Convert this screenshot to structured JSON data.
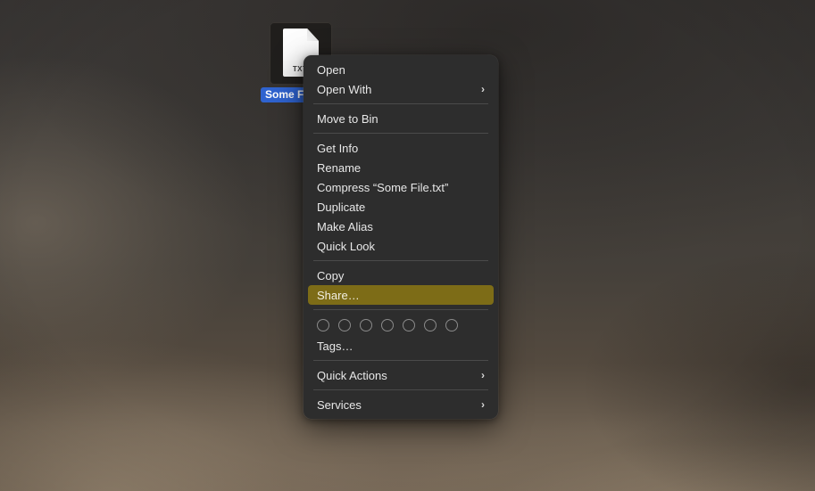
{
  "desktop": {
    "file_icon": {
      "name": "Some File.txt",
      "label_visible_text": "Some F",
      "type_badge": "TXT",
      "selection_color": "#2f63cf"
    }
  },
  "context_menu": {
    "highlight_color": "#7d6c17",
    "background_color": "#2d2d2d",
    "groups": [
      {
        "items": [
          {
            "label": "Open",
            "submenu": false
          },
          {
            "label": "Open With",
            "submenu": true,
            "arrow": "›"
          }
        ]
      },
      {
        "items": [
          {
            "label": "Move to Bin",
            "submenu": false
          }
        ]
      },
      {
        "items": [
          {
            "label": "Get Info",
            "submenu": false
          },
          {
            "label": "Rename",
            "submenu": false
          },
          {
            "label": "Compress “Some File.txt”",
            "submenu": false
          },
          {
            "label": "Duplicate",
            "submenu": false
          },
          {
            "label": "Make Alias",
            "submenu": false
          },
          {
            "label": "Quick Look",
            "submenu": false
          }
        ]
      },
      {
        "items": [
          {
            "label": "Copy",
            "submenu": false
          },
          {
            "label": "Share…",
            "submenu": false,
            "selected": true
          }
        ]
      },
      {
        "tags": {
          "dots": 7,
          "label": "Tags…"
        }
      },
      {
        "items": [
          {
            "label": "Quick Actions",
            "submenu": true,
            "arrow": "›"
          }
        ]
      },
      {
        "items": [
          {
            "label": "Services",
            "submenu": true,
            "arrow": "›"
          }
        ]
      }
    ]
  }
}
